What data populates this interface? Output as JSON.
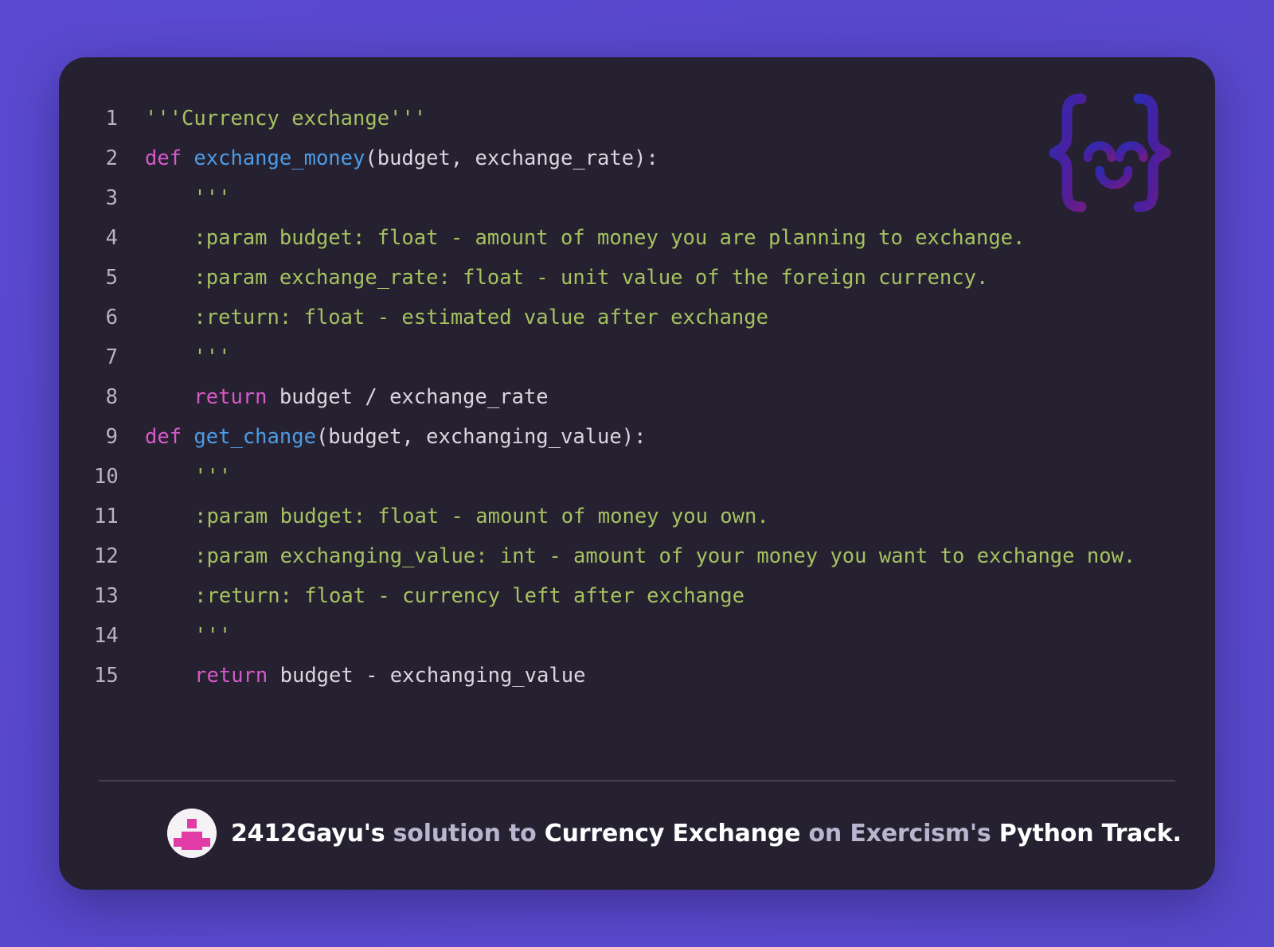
{
  "theme": {
    "page_background": "#5849cc",
    "card_background": "#262130",
    "divider_color": "#47415a",
    "line_number_color": "#b8b4c4",
    "string_color": "#a5c261",
    "keyword_color": "#d659c9",
    "function_color": "#4c9ce6",
    "identifier_color": "#d9d6e0",
    "accent_pink": "#e13ba6",
    "footer_muted_color": "#b9b5cf",
    "watermark_color_start": "#2d2a9e",
    "watermark_color_end": "#6b1f8f"
  },
  "watermark": {
    "icon": "exercism-logo-icon",
    "description": "curly brace smiley face"
  },
  "code": {
    "language": "python",
    "lines": [
      {
        "number": "1",
        "tokens": [
          {
            "text": "'''Currency exchange'''",
            "type": "str"
          }
        ]
      },
      {
        "number": "2",
        "tokens": [
          {
            "text": "def",
            "type": "kw"
          },
          {
            "text": " ",
            "type": "plain"
          },
          {
            "text": "exchange_money",
            "type": "fn"
          },
          {
            "text": "(budget, exchange_rate):",
            "type": "plain"
          }
        ]
      },
      {
        "number": "3",
        "tokens": [
          {
            "text": "    '''",
            "type": "str"
          }
        ]
      },
      {
        "number": "4",
        "tokens": [
          {
            "text": "    :param budget: float - amount of money you are planning to exchange.",
            "type": "doc"
          }
        ]
      },
      {
        "number": "5",
        "tokens": [
          {
            "text": "    :param exchange_rate: float - unit value of the foreign currency.",
            "type": "doc"
          }
        ]
      },
      {
        "number": "6",
        "tokens": [
          {
            "text": "    :return: float - estimated value after exchange",
            "type": "doc"
          }
        ]
      },
      {
        "number": "7",
        "tokens": [
          {
            "text": "    '''",
            "type": "str"
          }
        ]
      },
      {
        "number": "8",
        "tokens": [
          {
            "text": "    ",
            "type": "plain"
          },
          {
            "text": "return",
            "type": "kw"
          },
          {
            "text": " budget / exchange_rate",
            "type": "plain"
          }
        ]
      },
      {
        "number": "9",
        "tokens": [
          {
            "text": "def",
            "type": "kw"
          },
          {
            "text": " ",
            "type": "plain"
          },
          {
            "text": "get_change",
            "type": "fn"
          },
          {
            "text": "(budget, exchanging_value):",
            "type": "plain"
          }
        ]
      },
      {
        "number": "10",
        "tokens": [
          {
            "text": "    '''",
            "type": "str"
          }
        ]
      },
      {
        "number": "11",
        "tokens": [
          {
            "text": "    :param budget: float - amount of money you own.",
            "type": "doc"
          }
        ]
      },
      {
        "number": "12",
        "tokens": [
          {
            "text": "    :param exchanging_value: int - amount of your money you want to exchange now.",
            "type": "doc"
          }
        ]
      },
      {
        "number": "13",
        "tokens": [
          {
            "text": "    :return: float - currency left after exchange",
            "type": "doc"
          }
        ]
      },
      {
        "number": "14",
        "tokens": [
          {
            "text": "    '''",
            "type": "str"
          }
        ]
      },
      {
        "number": "15",
        "tokens": [
          {
            "text": "    ",
            "type": "plain"
          },
          {
            "text": "return",
            "type": "kw"
          },
          {
            "text": " budget - exchanging_value",
            "type": "plain"
          }
        ]
      }
    ]
  },
  "footer": {
    "avatar_icon": "user-avatar",
    "segments": [
      {
        "text": "2412Gayu's",
        "style": "strong"
      },
      {
        "text": " solution to ",
        "style": "muted"
      },
      {
        "text": "Currency Exchange",
        "style": "strong"
      },
      {
        "text": " on ",
        "style": "muted"
      },
      {
        "text": "Exercism's",
        "style": "muted"
      },
      {
        "text": " Python Track.",
        "style": "strong"
      }
    ],
    "full_text": "2412Gayu's solution to Currency Exchange on Exercism's Python Track."
  }
}
